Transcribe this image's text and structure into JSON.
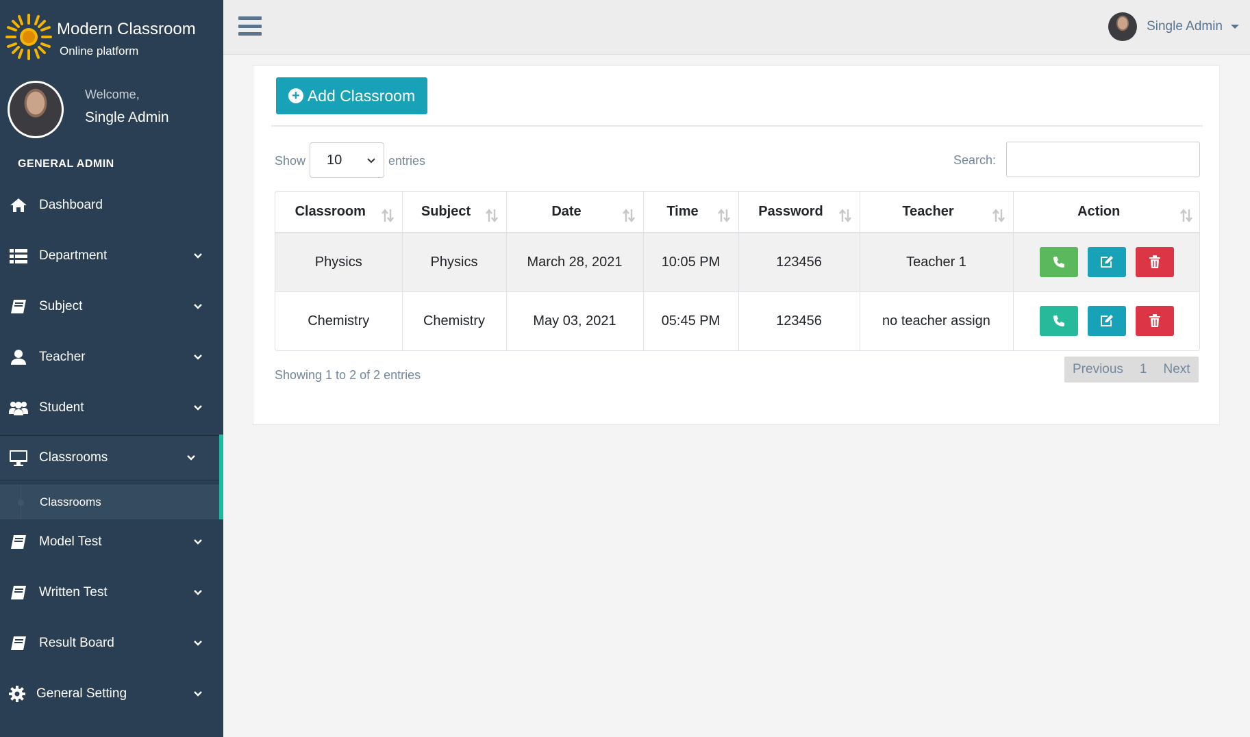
{
  "brand": {
    "title": "Modern Classroom",
    "subtitle": "Online platform"
  },
  "profile": {
    "welcome": "Welcome,",
    "name": "Single Admin"
  },
  "sidebar": {
    "section_title": "GENERAL ADMIN",
    "items": [
      {
        "label": "Dashboard",
        "icon": "home-icon"
      },
      {
        "label": "Department",
        "icon": "list-icon"
      },
      {
        "label": "Subject",
        "icon": "book-icon"
      },
      {
        "label": "Teacher",
        "icon": "user-icon"
      },
      {
        "label": "Student",
        "icon": "users-icon"
      },
      {
        "label": "Classrooms",
        "icon": "desktop-icon"
      },
      {
        "label": "Model Test",
        "icon": "book-icon"
      },
      {
        "label": "Written Test",
        "icon": "book-icon"
      },
      {
        "label": "Result Board",
        "icon": "book-icon"
      },
      {
        "label": "General Setting",
        "icon": "gear-icon"
      }
    ],
    "active_sub": "Classrooms"
  },
  "topbar": {
    "user_name": "Single Admin"
  },
  "toolbar": {
    "add_label": "Add Classroom"
  },
  "controls": {
    "show_label": "Show",
    "entries_value": "10",
    "entries_label": "entries",
    "search_label": "Search:",
    "search_value": ""
  },
  "table": {
    "headers": [
      "Classroom",
      "Subject",
      "Date",
      "Time",
      "Password",
      "Teacher",
      "Action"
    ],
    "rows": [
      {
        "classroom": "Physics",
        "subject": "Physics",
        "date": "March 28, 2021",
        "time": "10:05 PM",
        "password": "123456",
        "teacher": "Teacher 1"
      },
      {
        "classroom": "Chemistry",
        "subject": "Chemistry",
        "date": "May 03, 2021",
        "time": "05:45 PM",
        "password": "123456",
        "teacher": "no teacher assign"
      }
    ]
  },
  "footer": {
    "info": "Showing 1 to 2 of 2 entries",
    "prev": "Previous",
    "page": "1",
    "next": "Next"
  },
  "colors": {
    "sidebar_bg": "#2a3f54",
    "accent_teal": "#17a2b8",
    "active_bar": "#1abb9c",
    "call_green": "#5cb85c",
    "delete_red": "#dc3545"
  }
}
